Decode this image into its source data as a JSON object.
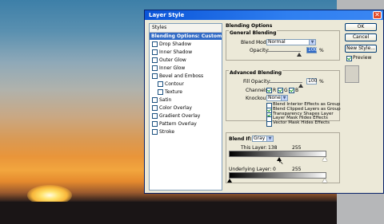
{
  "dialog": {
    "title": "Layer Style",
    "close_symbol": "✕"
  },
  "styles_panel": {
    "header": "Styles",
    "items": [
      {
        "label": "Blending Options: Custom",
        "checkbox": false,
        "selected": true,
        "indent": false
      },
      {
        "label": "Drop Shadow",
        "checkbox": true,
        "checked": false,
        "indent": false
      },
      {
        "label": "Inner Shadow",
        "checkbox": true,
        "checked": false,
        "indent": false
      },
      {
        "label": "Outer Glow",
        "checkbox": true,
        "checked": false,
        "indent": false
      },
      {
        "label": "Inner Glow",
        "checkbox": true,
        "checked": false,
        "indent": false
      },
      {
        "label": "Bevel and Emboss",
        "checkbox": true,
        "checked": false,
        "indent": false
      },
      {
        "label": "Contour",
        "checkbox": true,
        "checked": false,
        "indent": true
      },
      {
        "label": "Texture",
        "checkbox": true,
        "checked": false,
        "indent": true
      },
      {
        "label": "Satin",
        "checkbox": true,
        "checked": false,
        "indent": false
      },
      {
        "label": "Color Overlay",
        "checkbox": true,
        "checked": false,
        "indent": false
      },
      {
        "label": "Gradient Overlay",
        "checkbox": true,
        "checked": false,
        "indent": false
      },
      {
        "label": "Pattern Overlay",
        "checkbox": true,
        "checked": false,
        "indent": false
      },
      {
        "label": "Stroke",
        "checkbox": true,
        "checked": false,
        "indent": false
      }
    ]
  },
  "blending_options": {
    "title": "Blending Options",
    "general": {
      "title": "General Blending",
      "blend_mode_label": "Blend Mode:",
      "blend_mode_value": "Normal",
      "opacity_label": "Opacity:",
      "opacity_value": "100",
      "opacity_unit": "%"
    },
    "advanced": {
      "title": "Advanced Blending",
      "fill_opacity_label": "Fill Opacity:",
      "fill_opacity_value": "100",
      "fill_opacity_unit": "%",
      "channels_label": "Channels:",
      "channels": [
        "R",
        "G",
        "B"
      ],
      "knockout_label": "Knockout:",
      "knockout_value": "None",
      "options": [
        {
          "label": "Blend Interior Effects as Group",
          "checked": false
        },
        {
          "label": "Blend Clipped Layers as Group",
          "checked": true
        },
        {
          "label": "Transparency Shapes Layer",
          "checked": true
        },
        {
          "label": "Layer Mask Hides Effects",
          "checked": false
        },
        {
          "label": "Vector Mask Hides Effects",
          "checked": false
        }
      ]
    },
    "blend_if": {
      "label": "Blend If:",
      "value": "Gray",
      "this_layer_label": "This Layer:",
      "this_layer_low": "138",
      "this_layer_high": "255",
      "underlying_label": "Underlying Layer:",
      "underlying_low": "0",
      "underlying_high": "255"
    }
  },
  "buttons": {
    "ok": "OK",
    "cancel": "Cancel",
    "new_style": "New Style...",
    "preview_label": "Preview"
  },
  "dropdown_arrow": "▼"
}
